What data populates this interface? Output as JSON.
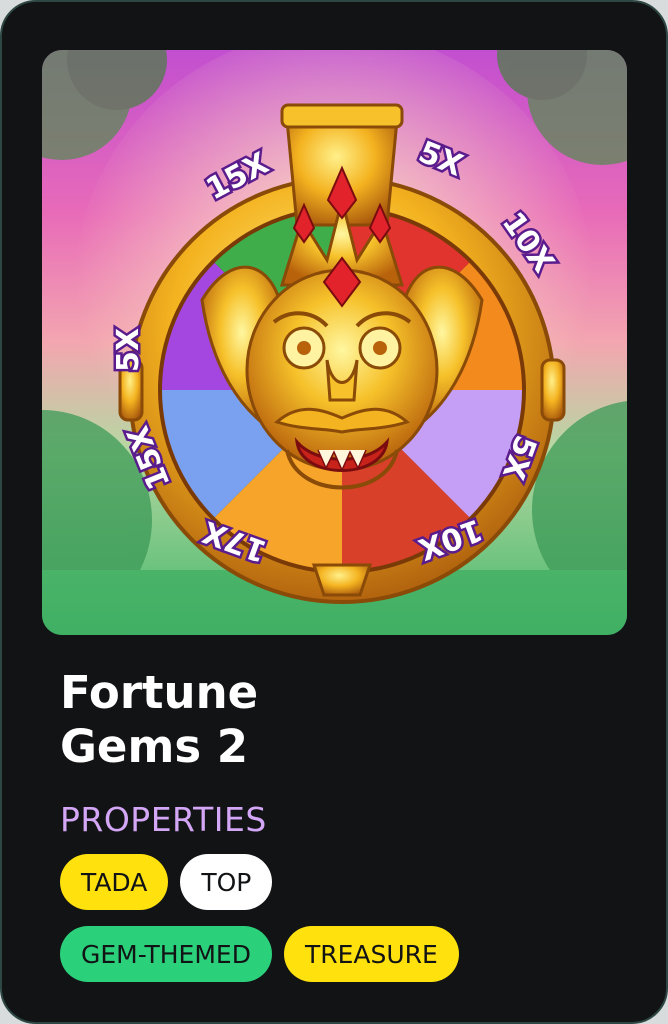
{
  "game": {
    "title_line1": "Fortune",
    "title_line2": "Gems 2",
    "section_label": "PROPERTIES",
    "wheel_multipliers": [
      "15X",
      "5X",
      "10X",
      "5X",
      "15X",
      "17X",
      "10X",
      "5X"
    ],
    "tags_row1": [
      {
        "label": "TADA",
        "color": "#ffe20d"
      },
      {
        "label": "TOP",
        "color": "#ffffff"
      }
    ],
    "tags_row2": [
      {
        "label": "GEM-THEMED",
        "color": "#2ad07a"
      },
      {
        "label": "TREASURE",
        "color": "#ffe20d"
      }
    ]
  },
  "colors": {
    "card_background": "#121315",
    "card_border": "#2e4744",
    "properties_label": "#d3a6f6"
  }
}
